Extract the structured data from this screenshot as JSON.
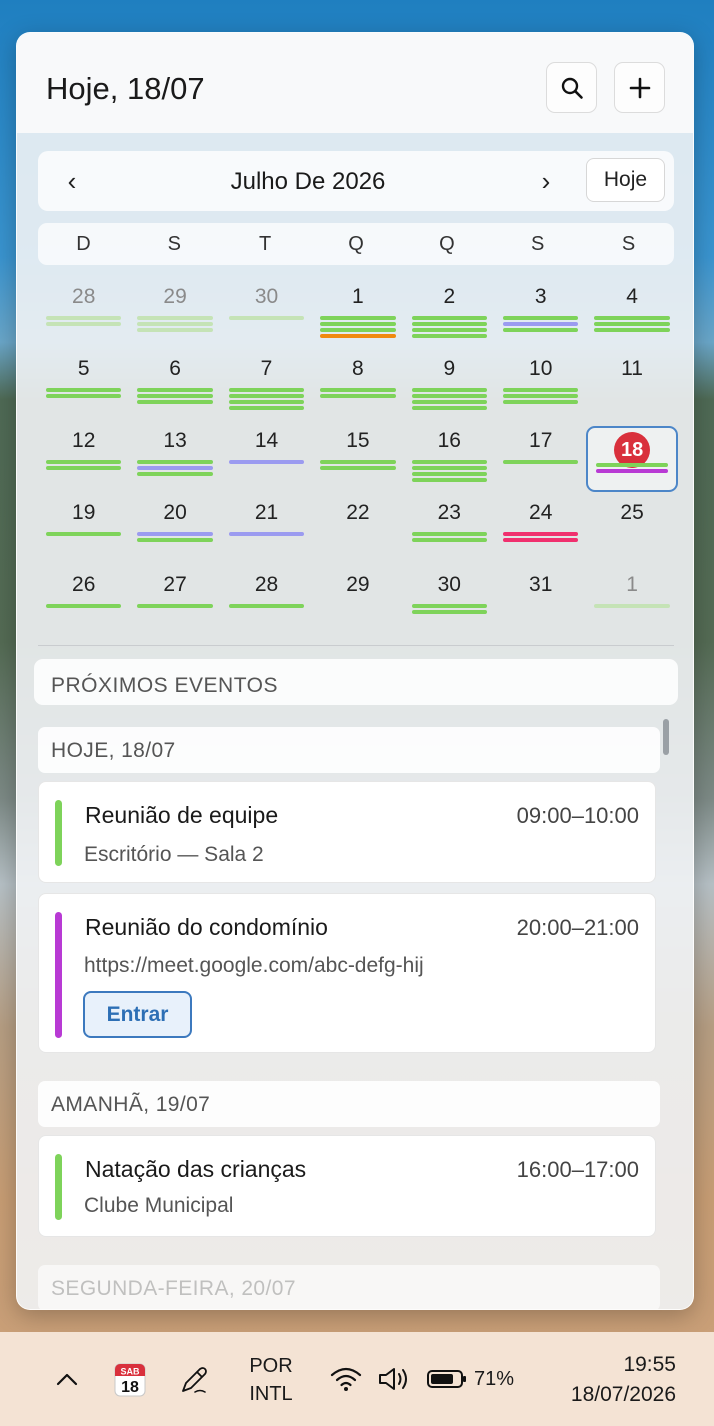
{
  "panel": {
    "title": "Hoje, 18/07",
    "search_icon": "search-icon",
    "add_icon": "plus-icon"
  },
  "month_nav": {
    "prev": "‹",
    "next": "›",
    "label": "Julho De 2026",
    "today_button": "Hoje"
  },
  "weekdays": [
    "D",
    "S",
    "T",
    "Q",
    "Q",
    "S",
    "S"
  ],
  "colors": {
    "green": "#7ed35a",
    "green_faded": "#c5e3b6",
    "lavender": "#9b9bf0",
    "orange": "#f08a10",
    "pink": "#f0306e",
    "purple": "#b83ad4",
    "today_badge": "#d9303c",
    "accent_blue": "#3c79be"
  },
  "calendar": {
    "weeks": [
      [
        {
          "day": "28",
          "muted": true,
          "bars": [
            "green_faded",
            "green_faded"
          ]
        },
        {
          "day": "29",
          "muted": true,
          "bars": [
            "green_faded",
            "green_faded",
            "green_faded"
          ]
        },
        {
          "day": "30",
          "muted": true,
          "bars": [
            "green_faded"
          ]
        },
        {
          "day": "1",
          "bars": [
            "green",
            "green",
            "green",
            "orange"
          ]
        },
        {
          "day": "2",
          "bars": [
            "green",
            "green",
            "green",
            "green"
          ]
        },
        {
          "day": "3",
          "bars": [
            "green",
            "lavender",
            "green"
          ]
        },
        {
          "day": "4",
          "bars": [
            "green",
            "green",
            "green"
          ]
        }
      ],
      [
        {
          "day": "5",
          "bars": [
            "green",
            "green"
          ]
        },
        {
          "day": "6",
          "bars": [
            "green",
            "green",
            "green"
          ]
        },
        {
          "day": "7",
          "bars": [
            "green",
            "green",
            "green",
            "green"
          ]
        },
        {
          "day": "8",
          "bars": [
            "green",
            "green"
          ]
        },
        {
          "day": "9",
          "bars": [
            "green",
            "green",
            "green",
            "green"
          ]
        },
        {
          "day": "10",
          "bars": [
            "green",
            "green",
            "green"
          ]
        },
        {
          "day": "11",
          "bars": []
        }
      ],
      [
        {
          "day": "12",
          "bars": [
            "green",
            "green"
          ]
        },
        {
          "day": "13",
          "bars": [
            "green",
            "lavender",
            "green"
          ]
        },
        {
          "day": "14",
          "bars": [
            "lavender"
          ]
        },
        {
          "day": "15",
          "bars": [
            "green",
            "green"
          ]
        },
        {
          "day": "16",
          "bars": [
            "green",
            "green",
            "green",
            "green"
          ]
        },
        {
          "day": "17",
          "bars": [
            "green"
          ]
        },
        {
          "day": "18",
          "today": true,
          "bars": [
            "green",
            "purple"
          ]
        }
      ],
      [
        {
          "day": "19",
          "bars": [
            "green"
          ]
        },
        {
          "day": "20",
          "bars": [
            "lavender",
            "green"
          ]
        },
        {
          "day": "21",
          "bars": [
            "lavender"
          ]
        },
        {
          "day": "22",
          "bars": []
        },
        {
          "day": "23",
          "bars": [
            "green",
            "green"
          ]
        },
        {
          "day": "24",
          "bars": [
            "pink",
            "pink"
          ]
        },
        {
          "day": "25",
          "bars": []
        }
      ],
      [
        {
          "day": "26",
          "bars": [
            "green"
          ]
        },
        {
          "day": "27",
          "bars": [
            "green"
          ]
        },
        {
          "day": "28",
          "bars": [
            "green"
          ]
        },
        {
          "day": "29",
          "bars": []
        },
        {
          "day": "30",
          "bars": [
            "green",
            "green"
          ]
        },
        {
          "day": "31",
          "bars": []
        },
        {
          "day": "1",
          "muted": true,
          "bars": [
            "green_faded"
          ]
        }
      ]
    ]
  },
  "upcoming": {
    "section_title": "PRÓXIMOS EVENTOS",
    "groups": [
      {
        "header": "HOJE, 18/07",
        "events": [
          {
            "title": "Reunião de equipe",
            "time": "09:00–10:00",
            "subtitle": "Escritório — Sala 2",
            "color": "green"
          },
          {
            "title": "Reunião do condomínio",
            "time": "20:00–21:00",
            "subtitle": "https://meet.google.com/abc-defg-hij",
            "color": "purple",
            "join_label": "Entrar"
          }
        ]
      },
      {
        "header": "AMANHÃ, 19/07",
        "events": [
          {
            "title": "Natação das crianças",
            "time": "16:00–17:00",
            "subtitle": "Clube Municipal",
            "color": "green"
          }
        ]
      }
    ],
    "next_group_header": "SEGUNDA-FEIRA, 20/07"
  },
  "taskbar": {
    "calendar_icon_month": "SAB",
    "calendar_icon_day": "18",
    "lang_line1": "POR",
    "lang_line2": "INTL",
    "battery_pct": "71%",
    "time": "19:55",
    "date": "18/07/2026"
  }
}
